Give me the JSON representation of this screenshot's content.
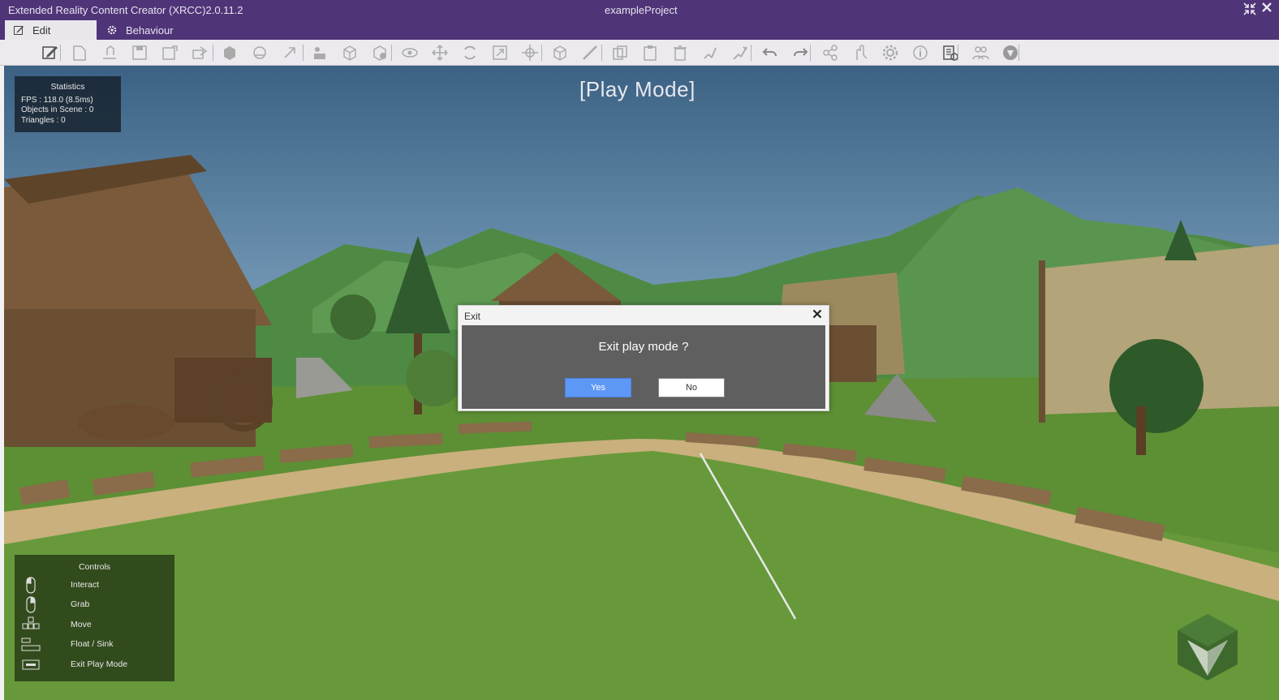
{
  "window": {
    "app_title": "Extended Reality Content Creator (XRCC)2.0.11.2",
    "project_name": "exampleProject",
    "restore_icon": "restore-icon",
    "close_icon": "close-icon"
  },
  "tabs": [
    {
      "label": "Edit",
      "icon": "pencil-icon",
      "active": true
    },
    {
      "label": "Behaviour",
      "icon": "gear-icon",
      "active": false
    }
  ],
  "toolbar": {
    "icons": [
      "edit-icon",
      "new-file-icon",
      "open-file-icon",
      "save-icon",
      "save-as-icon",
      "export-icon",
      "import-model-icon",
      "import-package-icon",
      "import-asset-icon",
      "add-object-icon",
      "add-cube-icon",
      "add-primitive-icon",
      "visibility-icon",
      "move-icon",
      "rotate-icon",
      "scale-icon",
      "pivot-icon",
      "bounds-icon",
      "measure-icon",
      "copy-icon",
      "paste-icon",
      "delete-icon",
      "snap-icon",
      "group-icon",
      "undo-icon",
      "redo-icon",
      "share-icon",
      "hand-interact-icon",
      "settings-icon",
      "info-icon",
      "report-icon",
      "users-icon",
      "help-icon"
    ]
  },
  "viewport": {
    "mode_label": "[Play Mode]"
  },
  "statistics": {
    "title": "Statistics",
    "fps": "FPS : 118.0 (8.5ms)",
    "objects": "Objects in Scene : 0",
    "triangles": "Triangles : 0"
  },
  "controls": {
    "title": "Controls",
    "items": [
      {
        "label": "Interact",
        "icon": "mouse-left-icon"
      },
      {
        "label": "Grab",
        "icon": "mouse-right-icon"
      },
      {
        "label": "Move",
        "icon": "wasd-keys-icon"
      },
      {
        "label": "Float / Sink",
        "icon": "space-key-icon"
      },
      {
        "label": "Exit Play Mode",
        "icon": "esc-key-icon"
      }
    ]
  },
  "dialog": {
    "title": "Exit",
    "message": "Exit play mode ?",
    "yes_label": "Yes",
    "no_label": "No"
  },
  "colors": {
    "titlebar": "#4f3478",
    "toolbar": "#eceaef",
    "accent_button": "#5d98f6"
  }
}
